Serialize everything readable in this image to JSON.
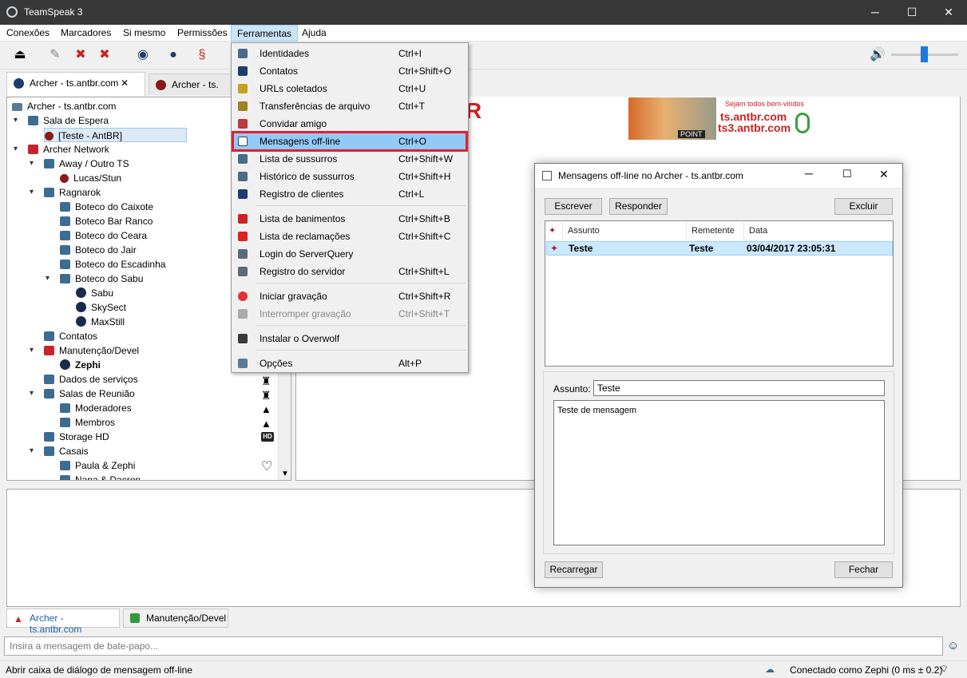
{
  "app": {
    "title": "TeamSpeak 3"
  },
  "window_controls": {
    "minimize": "─",
    "maximize": "☐",
    "close": "✕"
  },
  "menubar": [
    "Conexões",
    "Marcadores",
    "Si mesmo",
    "Permissões",
    "Ferramentas",
    "Ajuda"
  ],
  "server_tabs": [
    {
      "label": "Archer - ts.antbr.com",
      "close": "✕"
    },
    {
      "label": "Archer - ts."
    }
  ],
  "tree": {
    "server": "Archer - ts.antbr.com",
    "items": [
      {
        "label": "Sala de Espera"
      },
      {
        "label": "[Teste - AntBR]"
      },
      {
        "label": "Archer Network"
      },
      {
        "label": "Away / Outro TS"
      },
      {
        "label": "Lucas/Stun"
      },
      {
        "label": "Ragnarok"
      },
      {
        "label": "Boteco do Caixote"
      },
      {
        "label": "Boteco Bar Ranco"
      },
      {
        "label": "Boteco do Ceara"
      },
      {
        "label": "Boteco do Jair"
      },
      {
        "label": "Boteco do Escadinha"
      },
      {
        "label": "Boteco do Sabu"
      },
      {
        "label": "Sabu"
      },
      {
        "label": "SkySect"
      },
      {
        "label": "MaxStill"
      },
      {
        "label": "Contatos"
      },
      {
        "label": "Manutenção/Devel"
      },
      {
        "label": "Zephi"
      },
      {
        "label": "Dados de serviços"
      },
      {
        "label": "Salas de Reunião"
      },
      {
        "label": "Moderadores"
      },
      {
        "label": "Membros"
      },
      {
        "label": "Storage HD"
      },
      {
        "label": "Casais"
      },
      {
        "label": "Paula & Zephi"
      },
      {
        "label": "Nana & Dacron"
      }
    ],
    "badge_hd": "HD"
  },
  "dropdown": {
    "items": [
      {
        "label": "Identidades",
        "shortcut": "Ctrl+I"
      },
      {
        "label": "Contatos",
        "shortcut": "Ctrl+Shift+O"
      },
      {
        "label": "URLs coletados",
        "shortcut": "Ctrl+U"
      },
      {
        "label": "Transferências de arquivo",
        "shortcut": "Ctrl+T"
      },
      {
        "label": "Convidar amigo",
        "shortcut": ""
      },
      {
        "label": "Mensagens off-line",
        "shortcut": "Ctrl+O"
      },
      {
        "label": "Lista de sussurros",
        "shortcut": "Ctrl+Shift+W"
      },
      {
        "label": "Histórico de sussurros",
        "shortcut": "Ctrl+Shift+H"
      },
      {
        "label": "Registro de clientes",
        "shortcut": "Ctrl+L"
      },
      {
        "label": "Lista de banimentos",
        "shortcut": "Ctrl+Shift+B"
      },
      {
        "label": "Lista de reclamações",
        "shortcut": "Ctrl+Shift+C"
      },
      {
        "label": "Login do ServerQuery",
        "shortcut": ""
      },
      {
        "label": "Registro do servidor",
        "shortcut": "Ctrl+Shift+L"
      },
      {
        "label": "Iniciar gravação",
        "shortcut": "Ctrl+Shift+R"
      },
      {
        "label": "Interromper gravação",
        "shortcut": "Ctrl+Shift+T"
      },
      {
        "label": "Instalar o Overwolf",
        "shortcut": ""
      },
      {
        "label": "Opções",
        "shortcut": "Alt+P"
      }
    ]
  },
  "banner": {
    "welcome": "Sejam todos bem-vindos",
    "host1": "ts.antbr.com",
    "host2": "ts3.antbr.com",
    "point": "POINT",
    "fragment": "R"
  },
  "dialog": {
    "title": "Mensagens off-line no Archer - ts.antbr.com",
    "buttons": {
      "write": "Escrever",
      "reply": "Responder",
      "delete": "Excluir",
      "reload": "Recarregar",
      "close": "Fechar"
    },
    "columns": [
      "Assunto",
      "Remetente",
      "Data"
    ],
    "messages": [
      {
        "subject": "Teste",
        "sender": "Teste",
        "date": "03/04/2017 23:05:31"
      }
    ],
    "subject_label": "Assunto:",
    "subject_value": "Teste",
    "body": "Teste de mensagem"
  },
  "bottom_tabs": [
    "Archer - ts.antbr.com",
    "Manutenção/Devel"
  ],
  "chat": {
    "placeholder": "Insira a mensagem de bate-papo..."
  },
  "status": {
    "left": "Abrir caixa de diálogo de mensagem off-line",
    "right": "Conectado como Zephi (0 ms ± 0.2)"
  }
}
